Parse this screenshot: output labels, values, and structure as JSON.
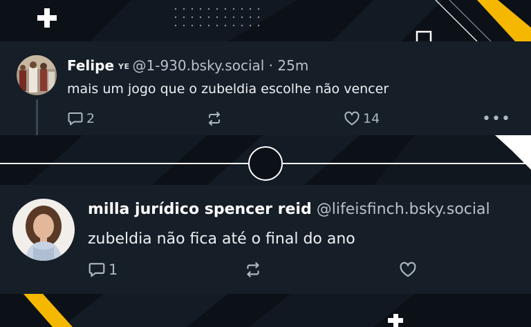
{
  "colors": {
    "accent": "#f5b700",
    "card_bg": "#161e27",
    "page_bg": "#0c1117",
    "text": "#eef1f4",
    "muted": "#aeb8c2"
  },
  "posts": [
    {
      "author_name": "Felipe",
      "author_badge": "YE",
      "handle": "@1-930.bsky.social",
      "time": "25m",
      "text": "mais um jogo que o zubeldia escolhe não vencer",
      "reply_count": "2",
      "like_count": "14",
      "icons": [
        "reply-icon",
        "repost-icon",
        "heart-icon",
        "more-icon"
      ]
    },
    {
      "author_name": "milla jurídico spencer reid",
      "handle": "@lifeisfinch.bsky.social",
      "text": "zubeldia não fica até o final do ano",
      "reply_count": "1",
      "icons": [
        "reply-icon",
        "repost-icon",
        "heart-icon"
      ]
    }
  ]
}
